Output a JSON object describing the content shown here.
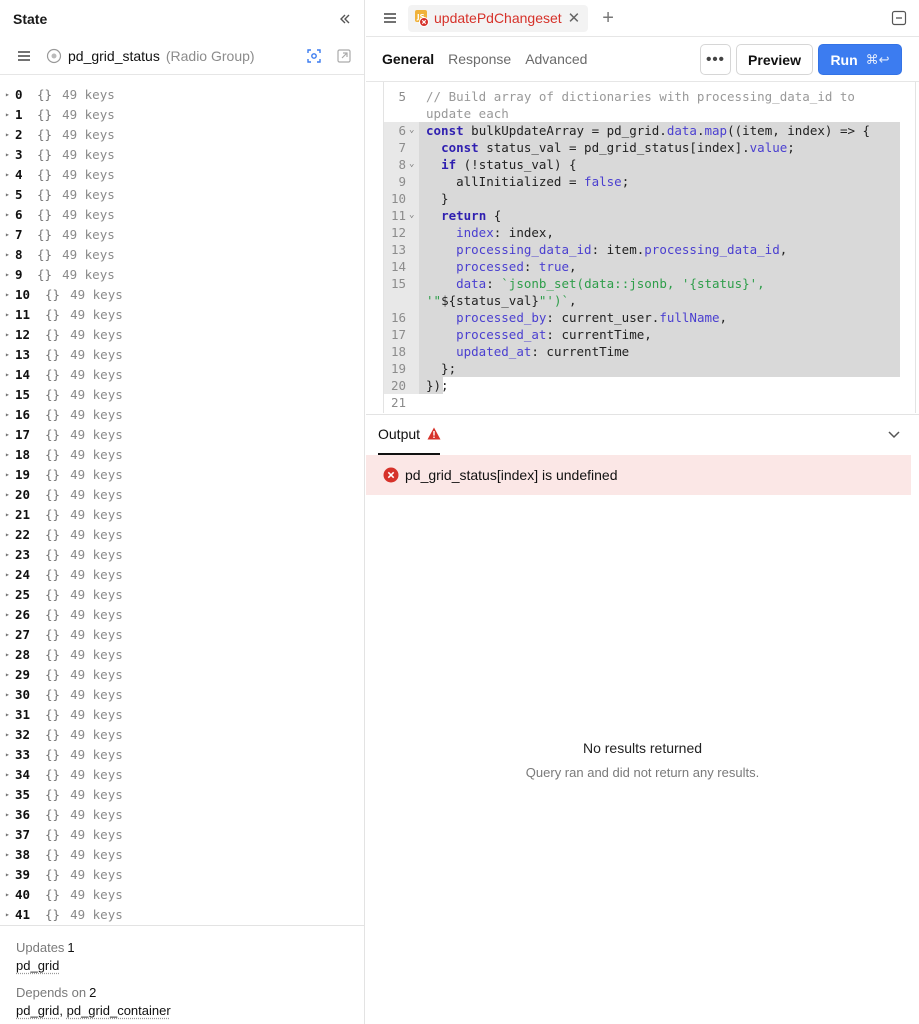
{
  "left": {
    "title": "State",
    "component_name": "pd_grid_status",
    "component_type": "(Radio Group)",
    "rows": [
      {
        "index": "0",
        "braces": "{}",
        "keys": "49 keys"
      },
      {
        "index": "1",
        "braces": "{}",
        "keys": "49 keys"
      },
      {
        "index": "2",
        "braces": "{}",
        "keys": "49 keys"
      },
      {
        "index": "3",
        "braces": "{}",
        "keys": "49 keys"
      },
      {
        "index": "4",
        "braces": "{}",
        "keys": "49 keys"
      },
      {
        "index": "5",
        "braces": "{}",
        "keys": "49 keys"
      },
      {
        "index": "6",
        "braces": "{}",
        "keys": "49 keys"
      },
      {
        "index": "7",
        "braces": "{}",
        "keys": "49 keys"
      },
      {
        "index": "8",
        "braces": "{}",
        "keys": "49 keys"
      },
      {
        "index": "9",
        "braces": "{}",
        "keys": "49 keys"
      },
      {
        "index": "10",
        "braces": "{}",
        "keys": "49 keys"
      },
      {
        "index": "11",
        "braces": "{}",
        "keys": "49 keys"
      },
      {
        "index": "12",
        "braces": "{}",
        "keys": "49 keys"
      },
      {
        "index": "13",
        "braces": "{}",
        "keys": "49 keys"
      },
      {
        "index": "14",
        "braces": "{}",
        "keys": "49 keys"
      },
      {
        "index": "15",
        "braces": "{}",
        "keys": "49 keys"
      },
      {
        "index": "16",
        "braces": "{}",
        "keys": "49 keys"
      },
      {
        "index": "17",
        "braces": "{}",
        "keys": "49 keys"
      },
      {
        "index": "18",
        "braces": "{}",
        "keys": "49 keys"
      },
      {
        "index": "19",
        "braces": "{}",
        "keys": "49 keys"
      },
      {
        "index": "20",
        "braces": "{}",
        "keys": "49 keys"
      },
      {
        "index": "21",
        "braces": "{}",
        "keys": "49 keys"
      },
      {
        "index": "22",
        "braces": "{}",
        "keys": "49 keys"
      },
      {
        "index": "23",
        "braces": "{}",
        "keys": "49 keys"
      },
      {
        "index": "24",
        "braces": "{}",
        "keys": "49 keys"
      },
      {
        "index": "25",
        "braces": "{}",
        "keys": "49 keys"
      },
      {
        "index": "26",
        "braces": "{}",
        "keys": "49 keys"
      },
      {
        "index": "27",
        "braces": "{}",
        "keys": "49 keys"
      },
      {
        "index": "28",
        "braces": "{}",
        "keys": "49 keys"
      },
      {
        "index": "29",
        "braces": "{}",
        "keys": "49 keys"
      },
      {
        "index": "30",
        "braces": "{}",
        "keys": "49 keys"
      },
      {
        "index": "31",
        "braces": "{}",
        "keys": "49 keys"
      },
      {
        "index": "32",
        "braces": "{}",
        "keys": "49 keys"
      },
      {
        "index": "33",
        "braces": "{}",
        "keys": "49 keys"
      },
      {
        "index": "34",
        "braces": "{}",
        "keys": "49 keys"
      },
      {
        "index": "35",
        "braces": "{}",
        "keys": "49 keys"
      },
      {
        "index": "36",
        "braces": "{}",
        "keys": "49 keys"
      },
      {
        "index": "37",
        "braces": "{}",
        "keys": "49 keys"
      },
      {
        "index": "38",
        "braces": "{}",
        "keys": "49 keys"
      },
      {
        "index": "39",
        "braces": "{}",
        "keys": "49 keys"
      },
      {
        "index": "40",
        "braces": "{}",
        "keys": "49 keys"
      },
      {
        "index": "41",
        "braces": "{}",
        "keys": "49 keys"
      }
    ],
    "footer": {
      "updates_label": "Updates",
      "updates_count": "1",
      "updates_items": [
        "pd_grid"
      ],
      "depends_label": "Depends on",
      "depends_count": "2",
      "depends_items": [
        "pd_grid",
        "pd_grid_container"
      ]
    }
  },
  "right": {
    "query_tab_name": "updatePdChangeset",
    "subtabs": [
      "General",
      "Response",
      "Advanced"
    ],
    "active_subtab": "General",
    "more_label": "•••",
    "preview_label": "Preview",
    "run_label": "Run",
    "run_shortcut": "⌘↩",
    "code_lines": [
      {
        "n": "5",
        "fold": "",
        "hl": false,
        "tokens": [
          [
            "cm",
            "// Build array of dictionaries with processing_data_id to"
          ]
        ]
      },
      {
        "n": "",
        "fold": "",
        "hl": false,
        "tokens": [
          [
            "cm",
            "update each"
          ]
        ]
      },
      {
        "n": "6",
        "fold": "⌄",
        "hl": true,
        "tokens": [
          [
            "kw",
            "const"
          ],
          [
            "idn",
            " bulkUpdateArray = pd_grid."
          ],
          [
            "pr",
            "data"
          ],
          [
            "idn",
            "."
          ],
          [
            "pr",
            "map"
          ],
          [
            "idn",
            "((item, index) => {"
          ]
        ]
      },
      {
        "n": "7",
        "fold": "",
        "hl": true,
        "tokens": [
          [
            "idn",
            "  "
          ],
          [
            "kw",
            "const"
          ],
          [
            "idn",
            " status_val = pd_grid_status[index]."
          ],
          [
            "pr",
            "value"
          ],
          [
            "idn",
            ";"
          ]
        ]
      },
      {
        "n": "8",
        "fold": "⌄",
        "hl": true,
        "tokens": [
          [
            "idn",
            "  "
          ],
          [
            "kw",
            "if"
          ],
          [
            "idn",
            " (!status_val) {"
          ]
        ]
      },
      {
        "n": "9",
        "fold": "",
        "hl": true,
        "tokens": [
          [
            "idn",
            "    allInitialized = "
          ],
          [
            "bool",
            "false"
          ],
          [
            "idn",
            ";"
          ]
        ]
      },
      {
        "n": "10",
        "fold": "",
        "hl": true,
        "tokens": [
          [
            "idn",
            "  }"
          ]
        ]
      },
      {
        "n": "11",
        "fold": "⌄",
        "hl": true,
        "tokens": [
          [
            "idn",
            "  "
          ],
          [
            "kw",
            "return"
          ],
          [
            "idn",
            " {"
          ]
        ]
      },
      {
        "n": "12",
        "fold": "",
        "hl": true,
        "tokens": [
          [
            "idn",
            "    "
          ],
          [
            "pr",
            "index"
          ],
          [
            "idn",
            ": index,"
          ]
        ]
      },
      {
        "n": "13",
        "fold": "",
        "hl": true,
        "tokens": [
          [
            "idn",
            "    "
          ],
          [
            "pr",
            "processing_data_id"
          ],
          [
            "idn",
            ": item."
          ],
          [
            "pr",
            "processing_data_id"
          ],
          [
            "idn",
            ","
          ]
        ]
      },
      {
        "n": "14",
        "fold": "",
        "hl": true,
        "tokens": [
          [
            "idn",
            "    "
          ],
          [
            "pr",
            "processed"
          ],
          [
            "idn",
            ": "
          ],
          [
            "bool",
            "true"
          ],
          [
            "idn",
            ","
          ]
        ]
      },
      {
        "n": "15",
        "fold": "",
        "hl": true,
        "tokens": [
          [
            "idn",
            "    "
          ],
          [
            "pr",
            "data"
          ],
          [
            "idn",
            ": "
          ],
          [
            "str",
            "`jsonb_set(data::jsonb, '{status}',"
          ]
        ]
      },
      {
        "n": "",
        "fold": "",
        "hl": true,
        "tokens": [
          [
            "str",
            "'\""
          ],
          [
            "idn",
            "${status_val}"
          ],
          [
            "str",
            "\"')`"
          ],
          [
            "idn",
            ","
          ]
        ]
      },
      {
        "n": "16",
        "fold": "",
        "hl": true,
        "tokens": [
          [
            "idn",
            "    "
          ],
          [
            "pr",
            "processed_by"
          ],
          [
            "idn",
            ": current_user."
          ],
          [
            "pr",
            "fullName"
          ],
          [
            "idn",
            ","
          ]
        ]
      },
      {
        "n": "17",
        "fold": "",
        "hl": true,
        "tokens": [
          [
            "idn",
            "    "
          ],
          [
            "pr",
            "processed_at"
          ],
          [
            "idn",
            ": currentTime,"
          ]
        ]
      },
      {
        "n": "18",
        "fold": "",
        "hl": true,
        "tokens": [
          [
            "idn",
            "    "
          ],
          [
            "pr",
            "updated_at"
          ],
          [
            "idn",
            ": currentTime"
          ]
        ]
      },
      {
        "n": "19",
        "fold": "",
        "hl": true,
        "tokens": [
          [
            "idn",
            "  };"
          ]
        ]
      },
      {
        "n": "20",
        "fold": "",
        "hl": true,
        "short": true,
        "tokens": [
          [
            "idn",
            "});"
          ]
        ]
      },
      {
        "n": "21",
        "fold": "",
        "hl": false,
        "tokens": [
          [
            "idn",
            ""
          ]
        ]
      }
    ],
    "output_label": "Output",
    "error_message": "pd_grid_status[index] is undefined",
    "empty_title": "No results returned",
    "empty_subtitle": "Query ran and did not return any results.",
    "colors": {
      "accent": "#3c7cf0",
      "error": "#d6322a",
      "error_bg": "#fbe7e6"
    }
  }
}
